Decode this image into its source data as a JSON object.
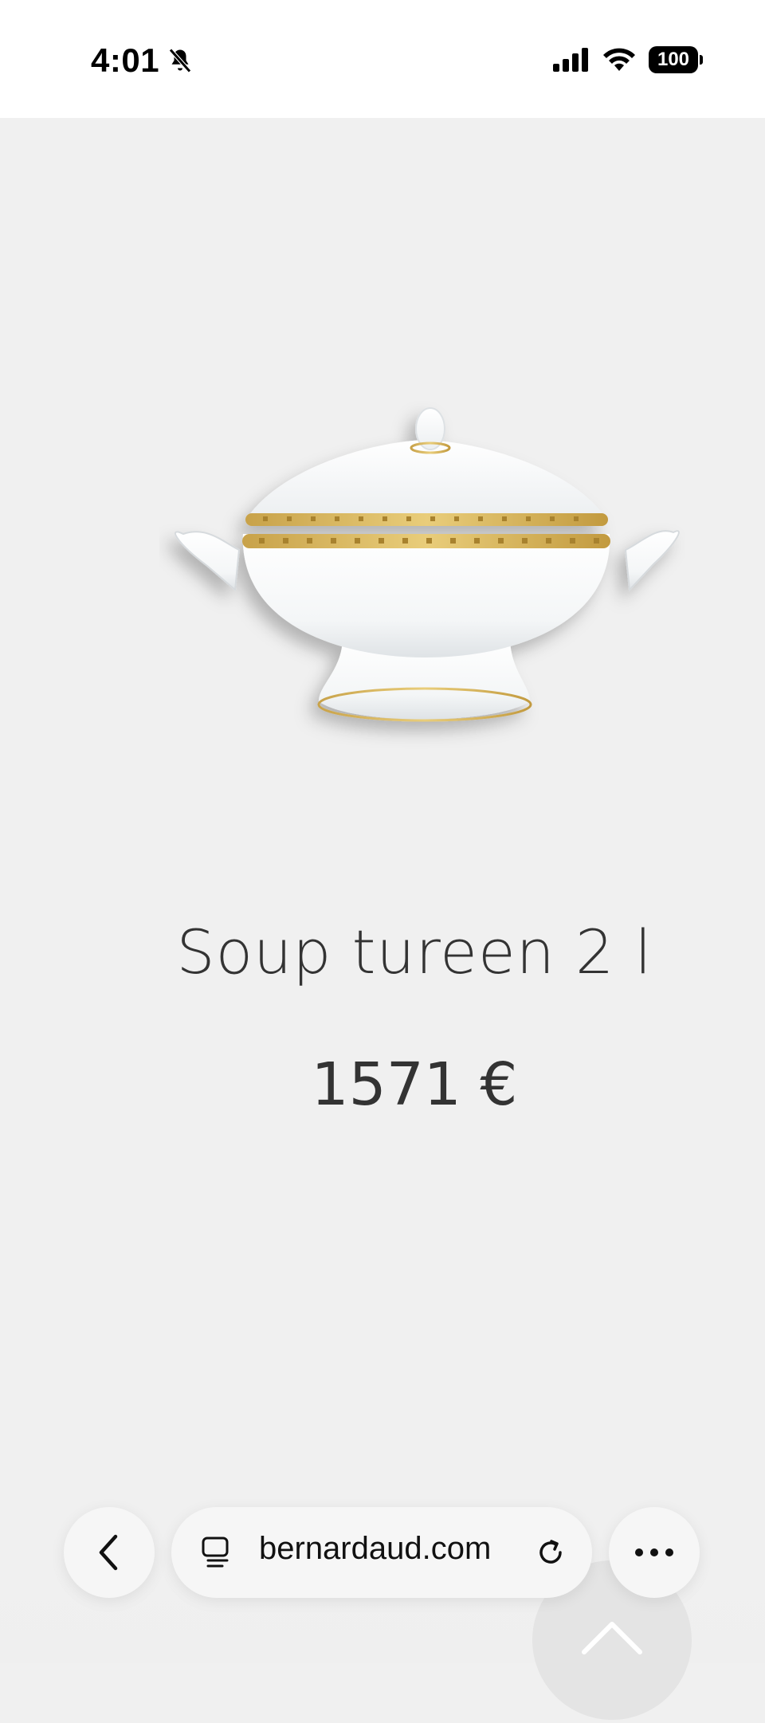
{
  "status_bar": {
    "time": "4:01",
    "battery": "100"
  },
  "product": {
    "title": "Soup tureen 2 l",
    "price": "1571 €",
    "image_icon": "soup-tureen-image"
  },
  "browser_bar": {
    "url": "bernardaud.com",
    "icons": [
      "back-icon",
      "tab-overview-icon",
      "reload-icon",
      "more-icon",
      "scroll-top-icon"
    ]
  }
}
